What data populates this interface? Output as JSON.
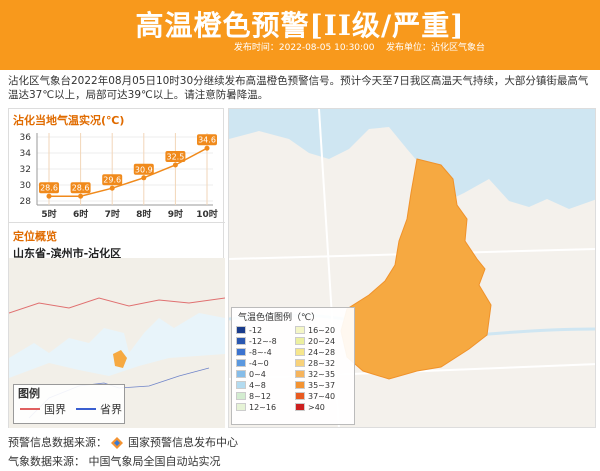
{
  "header": {
    "title": "高温橙色预警[II级/严重]",
    "issue_time_label": "发布时间：",
    "issue_time": "2022-08-05 10:30:00",
    "issuer_label": "发布单位：",
    "issuer": "沾化区气象台"
  },
  "description": "沾化区气象台2022年08月05日10时30分继续发布高温橙色预警信号。预计今天至7日我区高温天气持续，大部分镇街最高气温达37℃以上，局部可达39℃以上。请注意防暑降温。",
  "chart_title": "沾化当地气温实况(℃)",
  "chart_data": {
    "type": "line",
    "categories": [
      "5时",
      "6时",
      "7时",
      "8时",
      "9时",
      "10时"
    ],
    "values": [
      28.6,
      28.6,
      29.6,
      30.9,
      32.5,
      34.6
    ],
    "yticks": [
      28,
      30,
      32,
      34,
      36
    ],
    "ylim": [
      27.5,
      36.5
    ],
    "title": "沾化当地气温实况(℃)",
    "color": "#f08a1c"
  },
  "location": {
    "title": "定位概览",
    "text": "山东省-滨州市-沾化区"
  },
  "minimap_legend": {
    "title": "图例",
    "national_border": "国界",
    "provincial_border": "省界",
    "national_color": "#e06060",
    "provincial_color": "#3a5fd0"
  },
  "temp_legend": {
    "title": "气温色值图例（℃）",
    "items": [
      {
        "label": "-12",
        "color": "#1a3c8c"
      },
      {
        "label": "16~20",
        "color": "#f4f6c6"
      },
      {
        "label": "-12~-8",
        "color": "#2a57b0"
      },
      {
        "label": "20~24",
        "color": "#ecf0a0"
      },
      {
        "label": "-8~-4",
        "color": "#3c73cf"
      },
      {
        "label": "24~28",
        "color": "#f6e68c"
      },
      {
        "label": "-4~0",
        "color": "#5b98df"
      },
      {
        "label": "28~32",
        "color": "#f8d27a"
      },
      {
        "label": "0~4",
        "color": "#86bde9"
      },
      {
        "label": "32~35",
        "color": "#f6b45c"
      },
      {
        "label": "4~8",
        "color": "#b3dbf0"
      },
      {
        "label": "35~37",
        "color": "#f39332"
      },
      {
        "label": "8~12",
        "color": "#d3ecd0"
      },
      {
        "label": "37~40",
        "color": "#e85a20"
      },
      {
        "label": "12~16",
        "color": "#e6f3d6"
      },
      {
        "label": ">40",
        "color": "#cc1f1f"
      }
    ]
  },
  "footer": {
    "warning_source_label": "预警信息数据来源：",
    "warning_source": "国家预警信息发布中心",
    "weather_source_label": "气象数据来源：",
    "weather_source": "中国气象局全国自动站实况"
  },
  "colors": {
    "accent": "#f8991c",
    "region_fill": "#f6a941"
  }
}
